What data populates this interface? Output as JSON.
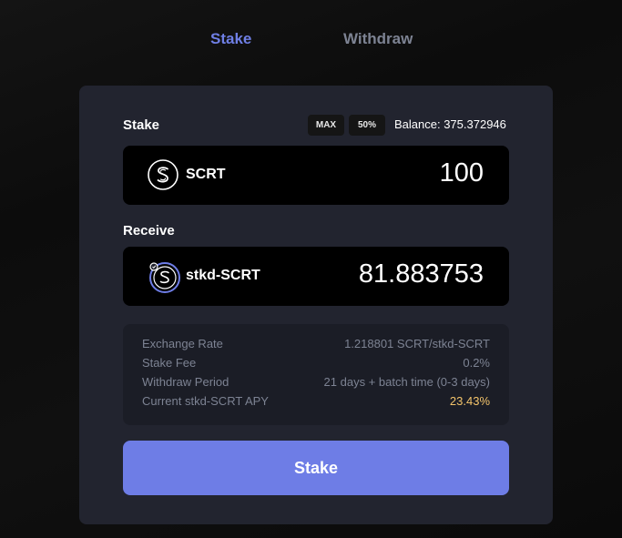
{
  "tabs": {
    "stake": "Stake",
    "withdraw": "Withdraw"
  },
  "stake_section": {
    "label": "Stake",
    "max_label": "MAX",
    "half_label": "50%",
    "balance": "Balance: 375.372946",
    "token": {
      "name": "SCRT",
      "icon": "secret-s-icon",
      "amount": "100"
    }
  },
  "receive_section": {
    "label": "Receive",
    "token": {
      "name": "stkd-SCRT",
      "icon": "stkd-scrt-icon",
      "amount": "81.883753"
    }
  },
  "info": {
    "rows": [
      {
        "key": "Exchange Rate",
        "value": "1.218801 SCRT/stkd-SCRT"
      },
      {
        "key": "Stake Fee",
        "value": "0.2%"
      },
      {
        "key": "Withdraw Period",
        "value": "21 days + batch time (0-3 days)"
      },
      {
        "key": "Current stkd-SCRT APY",
        "value": "23.43%"
      }
    ]
  },
  "submit_label": "Stake",
  "colors": {
    "accent": "#6e7de6",
    "apy": "#f3c46b",
    "muted": "#7d8393",
    "card": "#22242f"
  }
}
